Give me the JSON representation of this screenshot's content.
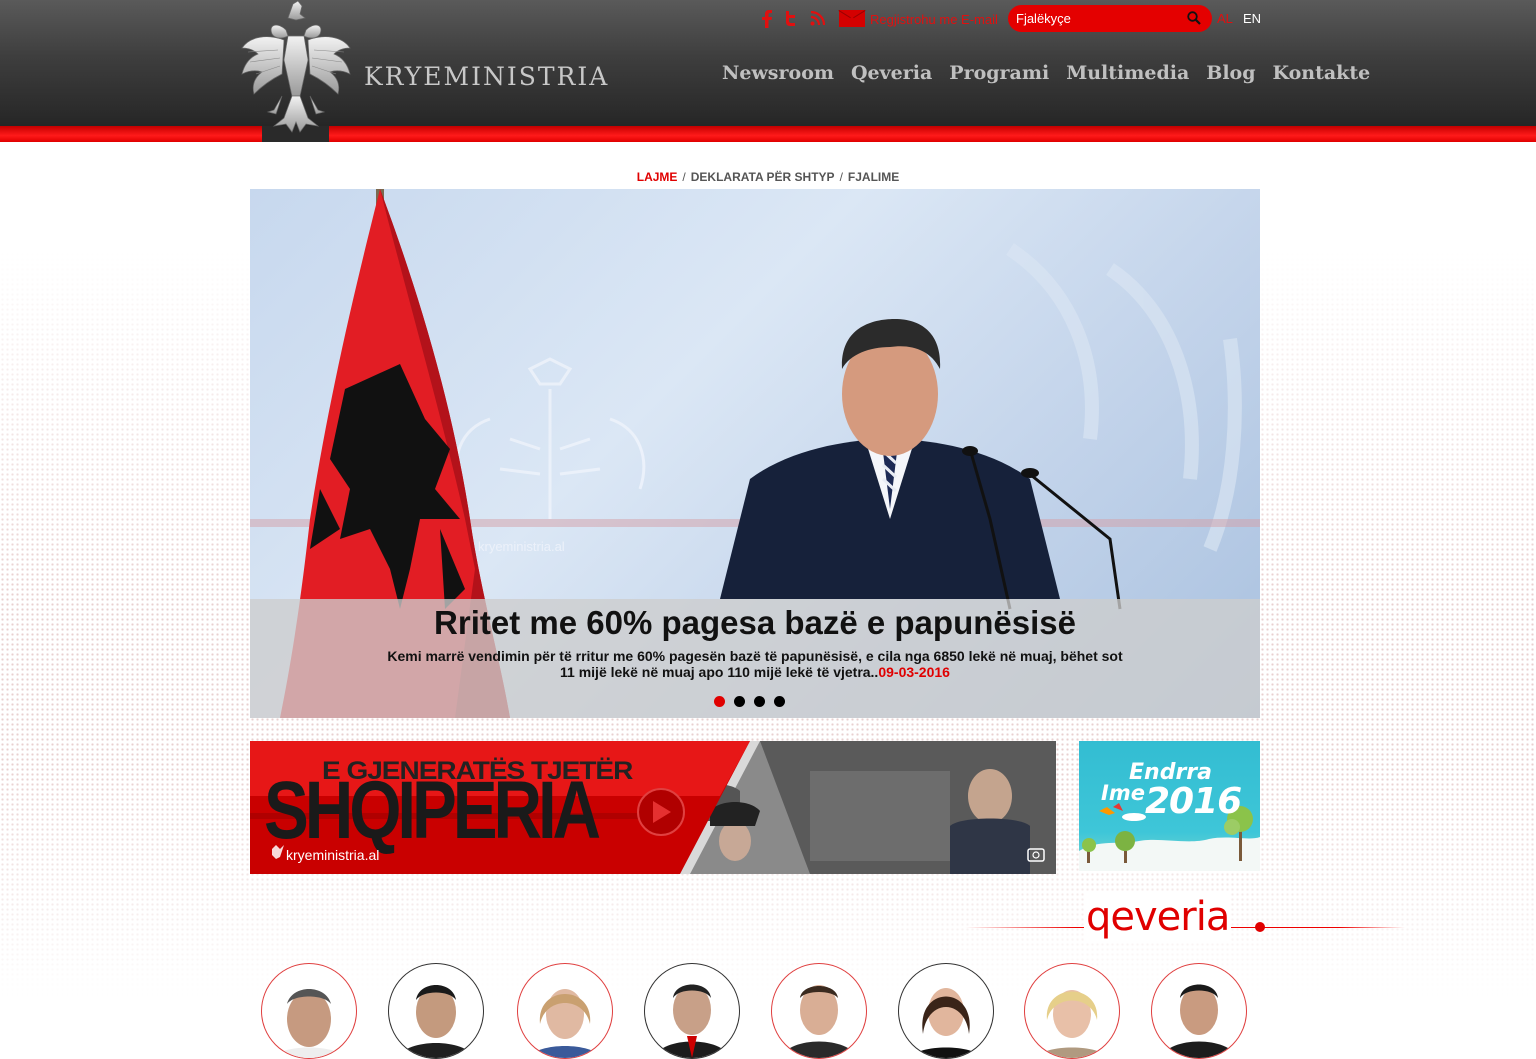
{
  "header": {
    "site_name": "KRYEMINISTRIA",
    "register_label": "Regjistrohu me E-mail",
    "search_placeholder": "Fjalëkyçe",
    "lang_al": "AL",
    "lang_en": "EN",
    "social": [
      "facebook-icon",
      "twitter-icon",
      "rss-icon"
    ],
    "nav": [
      "Newsroom",
      "Qeveria",
      "Programi",
      "Multimedia",
      "Blog",
      "Kontakte"
    ]
  },
  "breadcrumb": {
    "items": [
      "LAJME",
      "DEKLARATA PËR SHTYP",
      "FJALIME"
    ],
    "active": 0
  },
  "slider": {
    "title": "Rritet me 60% pagesa bazë e papunësisë",
    "text": "Kemi marrë vendimin për të rritur me 60% pagesën bazë të papunësisë, e cila nga 6850 lekë në muaj, bëhet sot 11 mijë lekë në muaj apo 110 mijë lekë të vjetra..",
    "date": "09-03-2016",
    "watermark": "kryeministria.al",
    "dots": 4,
    "active_dot": 0
  },
  "banner_video": {
    "line1": "E GJENERATËS TJETËR",
    "line2": "SHQIPERIA",
    "site": "kryeministria.al"
  },
  "banner_2016": {
    "line1": "Endrra",
    "line2": "Ime",
    "year": "2016"
  },
  "qeveria": {
    "title": "qeveria",
    "members": 8
  },
  "colors": {
    "accent": "#e00000",
    "header_dark": "#262626"
  }
}
